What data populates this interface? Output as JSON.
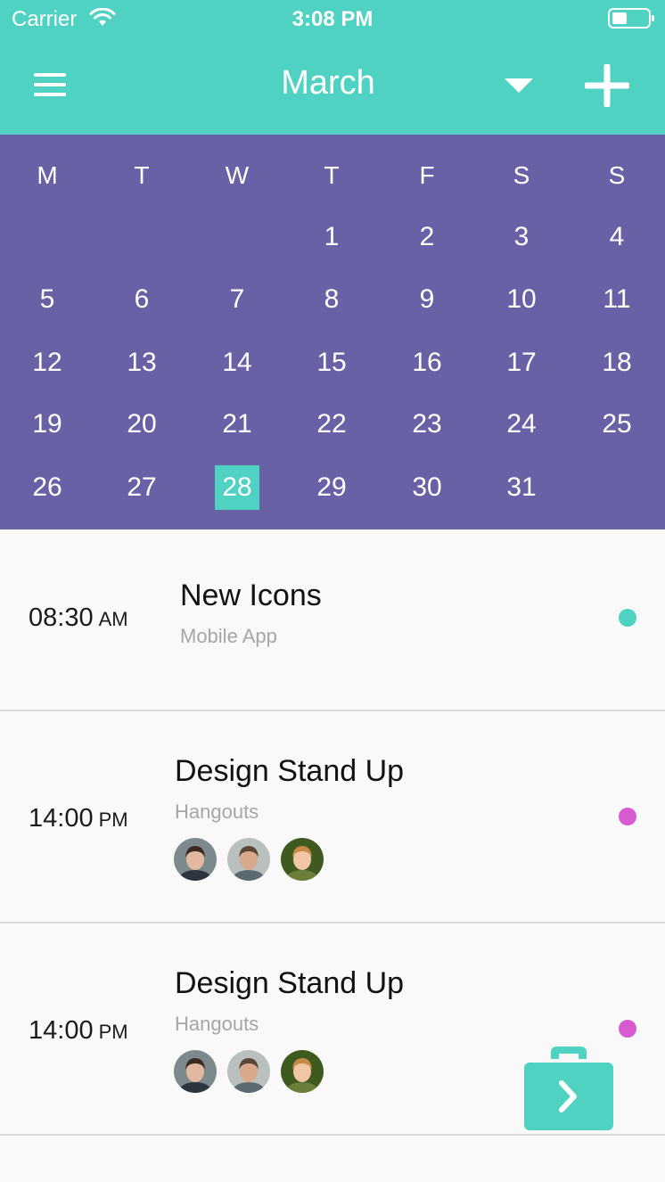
{
  "status_bar": {
    "carrier": "Carrier",
    "time": "3:08 PM"
  },
  "header": {
    "title": "March",
    "menu_icon": "hamburger-menu-icon",
    "dropdown_icon": "caret-down-icon",
    "add_icon": "plus-icon"
  },
  "calendar": {
    "weekdays": [
      "M",
      "T",
      "W",
      "T",
      "F",
      "S",
      "S"
    ],
    "weeks": [
      [
        "",
        "",
        "",
        "1",
        "2",
        "3",
        "4"
      ],
      [
        "5",
        "6",
        "7",
        "8",
        "9",
        "10",
        "11"
      ],
      [
        "12",
        "13",
        "14",
        "15",
        "16",
        "17",
        "18"
      ],
      [
        "19",
        "20",
        "21",
        "22",
        "23",
        "24",
        "25"
      ],
      [
        "26",
        "27",
        "28",
        "29",
        "30",
        "31",
        ""
      ]
    ],
    "selected_day": "28"
  },
  "events": [
    {
      "time": "08:30",
      "ampm": "AM",
      "title": "New Icons",
      "subtitle": "Mobile App",
      "dot_color": "#50d2c2",
      "attendees": []
    },
    {
      "time": "14:00",
      "ampm": "PM",
      "title": "Design Stand Up",
      "subtitle": "Hangouts",
      "dot_color": "#d65bd1",
      "attendees": [
        "avatar-man-1",
        "avatar-man-2",
        "avatar-woman-1"
      ]
    },
    {
      "time": "14:00",
      "ampm": "PM",
      "title": "Design Stand Up",
      "subtitle": "Hangouts",
      "dot_color": "#d65bd1",
      "attendees": [
        "avatar-man-1",
        "avatar-man-2",
        "avatar-woman-1"
      ]
    }
  ],
  "fab": {
    "icon": "briefcase-arrow-icon"
  },
  "colors": {
    "accent": "#50d2c2",
    "calendar_bg": "#6961a6",
    "event_dot_purple": "#d65bd1"
  }
}
